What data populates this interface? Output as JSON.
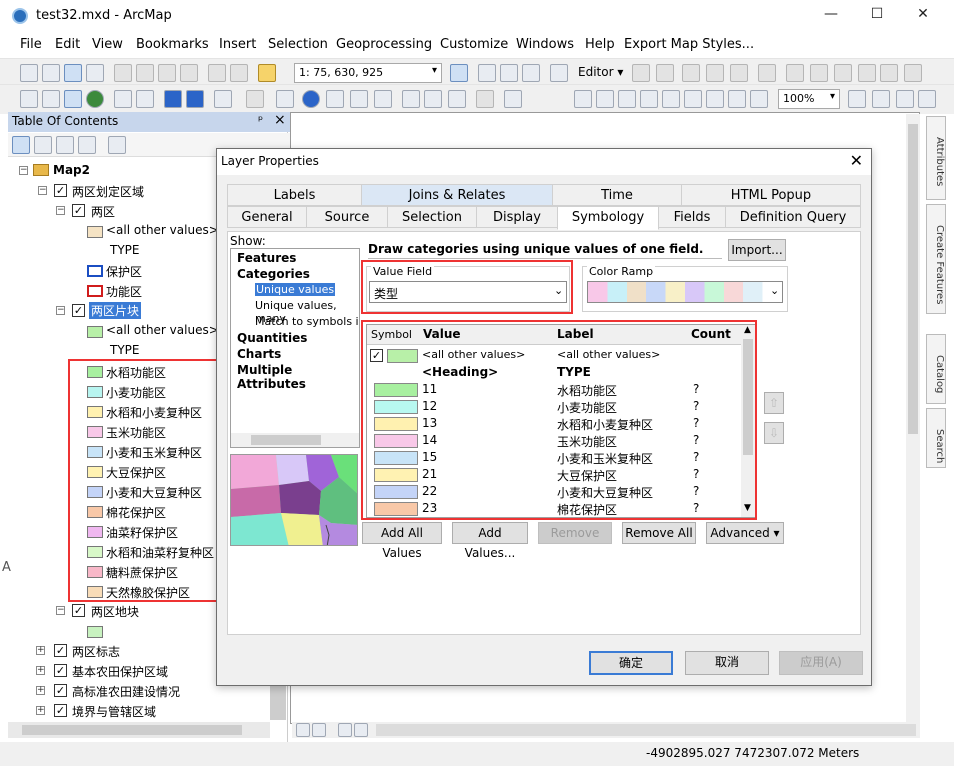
{
  "window": {
    "title": "test32.mxd - ArcMap",
    "minimize": "—",
    "maximize": "☐",
    "close": "✕"
  },
  "menu": [
    "File",
    "Edit",
    "View",
    "Bookmarks",
    "Insert",
    "Selection",
    "Geoprocessing",
    "Customize",
    "Windows",
    "Help",
    "Export Map Styles..."
  ],
  "toolbar": {
    "scale": "1: 75, 630, 925",
    "editor": "Editor ▾",
    "zoom": "100%"
  },
  "toc": {
    "title": "Table Of Contents",
    "pin": "ᵖ",
    "close": "×",
    "map": "Map2",
    "layers": [
      {
        "name": "两区划定区域"
      },
      {
        "name": "两区"
      },
      {
        "name": "<all other values>"
      },
      {
        "name": "TYPE"
      },
      {
        "name": "保护区"
      },
      {
        "name": "功能区"
      },
      {
        "name": "两区片块"
      },
      {
        "name": "<all other values>"
      },
      {
        "name": "TYPE"
      }
    ],
    "categories": [
      "水稻功能区",
      "小麦功能区",
      "水稻和小麦复种区",
      "玉米功能区",
      "小麦和玉米复种区",
      "大豆保护区",
      "小麦和大豆复种区",
      "棉花保护区",
      "油菜籽保护区",
      "水稻和油菜籽复种区",
      "糖料蔗保护区",
      "天然橡胶保护区"
    ],
    "cat_colors": [
      "#a8f0a0",
      "#b8f5f0",
      "#fff1b0",
      "#f8c8e8",
      "#c8e4f8",
      "#fff2b2",
      "#c4d4f8",
      "#f8c8a8",
      "#f0b8f0",
      "#d8f8c8",
      "#f8b8c8",
      "#f8dcb8"
    ],
    "after": [
      {
        "name": "两区地块"
      },
      {
        "name": "两区标志"
      },
      {
        "name": "基本农田保护区域"
      },
      {
        "name": "高标准农田建设情况"
      },
      {
        "name": "境界与管辖区域"
      }
    ]
  },
  "dialog": {
    "title": "Layer Properties",
    "tabs_row1": [
      "Labels",
      "Joins & Relates",
      "Time",
      "HTML Popup"
    ],
    "tabs_row2": [
      "General",
      "Source",
      "Selection",
      "Display",
      "Symbology",
      "Fields",
      "Definition Query"
    ],
    "show_label": "Show:",
    "show_items": [
      "Features",
      "Categories",
      "Unique values",
      "Unique values, many",
      "Match to symbols in a",
      "Quantities",
      "Charts",
      "Multiple Attributes"
    ],
    "heading": "Draw categories using unique values of one field.",
    "import_btn": "Import...",
    "value_field_label": "Value Field",
    "value_field": "类型",
    "color_ramp_label": "Color Ramp",
    "grid_headers": [
      "Symbol",
      "Value",
      "Label",
      "Count"
    ],
    "rows": [
      {
        "value": "<all other values>",
        "label": "<all other values>",
        "count": "",
        "color": "#b8f0a8"
      },
      {
        "value": "<Heading>",
        "label": "TYPE",
        "count": "",
        "color": ""
      },
      {
        "value": "11",
        "label": "水稻功能区",
        "count": "?",
        "color": "#a8f0a0"
      },
      {
        "value": "12",
        "label": "小麦功能区",
        "count": "?",
        "color": "#b8f8f0"
      },
      {
        "value": "13",
        "label": "水稻和小麦复种区",
        "count": "?",
        "color": "#fff1b0"
      },
      {
        "value": "14",
        "label": "玉米功能区",
        "count": "?",
        "color": "#f8c8e8"
      },
      {
        "value": "15",
        "label": "小麦和玉米复种区",
        "count": "?",
        "color": "#c8e4f8"
      },
      {
        "value": "21",
        "label": "大豆保护区",
        "count": "?",
        "color": "#fff2b2"
      },
      {
        "value": "22",
        "label": "小麦和大豆复种区",
        "count": "?",
        "color": "#c4d4f8"
      },
      {
        "value": "23",
        "label": "棉花保护区",
        "count": "?",
        "color": "#f8c8a8"
      }
    ],
    "buttons": {
      "add_all": "Add All Values",
      "add": "Add Values...",
      "remove": "Remove",
      "remove_all": "Remove All",
      "advanced": "Advanced"
    },
    "ok": "确定",
    "cancel": "取消",
    "apply": "应用(A)"
  },
  "right_tabs": [
    "Attributes",
    "Create Features",
    "Catalog",
    "Search"
  ],
  "status": {
    "coords": "-4902895.027  7472307.072 Meters"
  },
  "side_letter": "A"
}
